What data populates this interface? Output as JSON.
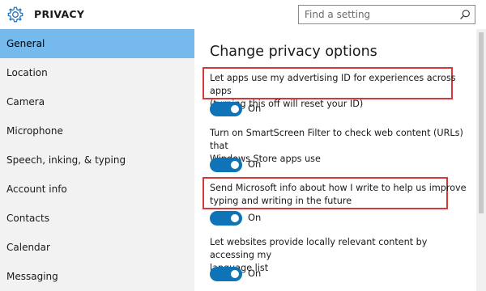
{
  "header": {
    "title": "PRIVACY",
    "icon": "gear-icon",
    "search_placeholder": "Find a setting"
  },
  "sidebar": {
    "items": [
      {
        "label": "General",
        "active": true
      },
      {
        "label": "Location"
      },
      {
        "label": "Camera"
      },
      {
        "label": "Microphone"
      },
      {
        "label": "Speech, inking, & typing"
      },
      {
        "label": "Account info"
      },
      {
        "label": "Contacts"
      },
      {
        "label": "Calendar"
      },
      {
        "label": "Messaging"
      }
    ]
  },
  "main": {
    "title": "Change privacy options",
    "options": [
      {
        "line1": "Let apps use my advertising ID for experiences across apps",
        "line2": "(turning this off will reset your ID)",
        "toggle": "On",
        "highlighted": true
      },
      {
        "line1": "Turn on SmartScreen Filter to check web content (URLs) that",
        "line2": "Windows Store apps use",
        "toggle": "On",
        "highlighted": false
      },
      {
        "line1": "Send Microsoft info about how I write to help us improve",
        "line2": "typing and writing in the future",
        "toggle": "On",
        "highlighted": true
      },
      {
        "line1": "Let websites provide locally relevant content by accessing my",
        "line2": "language list",
        "toggle": "On",
        "highlighted": false
      }
    ]
  },
  "colors": {
    "accent": "#76b9ed",
    "toggle_on": "#0f73b8",
    "highlight_border": "#d9383a",
    "sidebar_bg": "#f2f2f2"
  }
}
